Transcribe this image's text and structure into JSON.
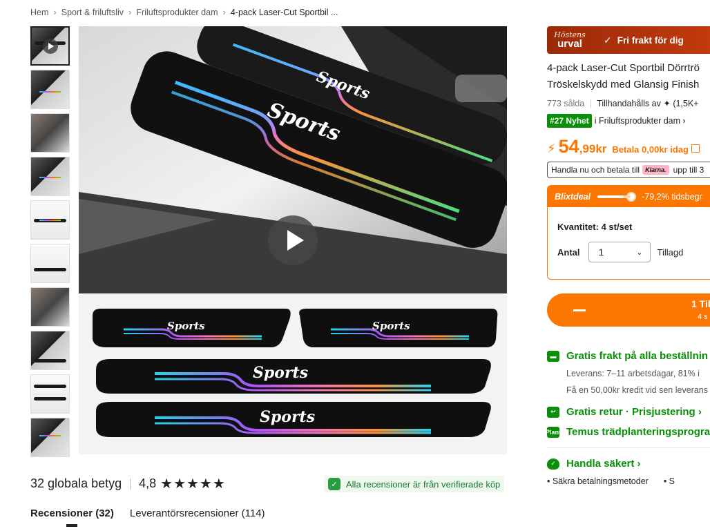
{
  "breadcrumb": [
    "Hem",
    "Sport & friluftsliv",
    "Friluftsprodukter dam",
    "4-pack Laser-Cut Sportbil ..."
  ],
  "thumbnails": [
    "video",
    "product",
    "hands",
    "product",
    "product",
    "product",
    "hands",
    "product",
    "product",
    "product"
  ],
  "gallery": {
    "sticker_text": "Sports",
    "play_icon": "play-icon"
  },
  "reviews": {
    "count_label": "32 globala betyg",
    "rating": "4,8",
    "stars_value": 4.8,
    "stars": "★★★★★",
    "verified": "Alla recensioner är från verifierade köp",
    "tabs": [
      "Recensioner (32)",
      "Leverantörsrecensioner (114)"
    ]
  },
  "banner": {
    "logo_line1": "Höstens",
    "logo_line2": "urval",
    "check": "✓",
    "free_shipping": "Fri frakt för dig"
  },
  "product": {
    "title_line1": "4-pack Laser-Cut Sportbil Dörrtrö",
    "title_line2": "Tröskelskydd med Glansig Finish",
    "sold": "773 sålda",
    "provided_by": "Tillhandahålls av",
    "seller_suffix": "(1,5K+",
    "rank_badge": "#27 Nyhet",
    "rank_text": "i Friluftsprodukter dam ›"
  },
  "price": {
    "bolt": "⚡",
    "whole": "54",
    "decimal": ",99kr",
    "pay_today": "Betala 0,00kr idag",
    "klarna_prefix": "Handla nu och betala till",
    "klarna_logo": "Klarna.",
    "klarna_suffix": "upp till 3"
  },
  "deal": {
    "name": "Blixtdeal",
    "progress": 0.79,
    "discount": "-79,2% tidsbegr",
    "quantity_label": "Kvantitet:",
    "quantity_value": "4 st/set",
    "amount_label": "Antal",
    "amount_value": "1",
    "added": "Tillagd"
  },
  "cart": {
    "add_label": "1 Til",
    "sub_label": "4 s"
  },
  "perks": {
    "shipping": "Gratis frakt på alla beställnin",
    "delivery": "Leverans: 7–11 arbetsdagar, 81% i",
    "credit": "Få en 50,00kr kredit vid sen leverans",
    "returns": "Gratis retur · Prisjustering ›",
    "plant_icon_text": "Plant",
    "planting": "Temus trädplanteringsprogra",
    "secure": "Handla säkert ›",
    "bullets": [
      "• Säkra betalningsmetoder",
      "• S"
    ]
  },
  "colors": {
    "orange": "#fb7701",
    "green": "#0a8f08",
    "banner": "#b3320b"
  }
}
